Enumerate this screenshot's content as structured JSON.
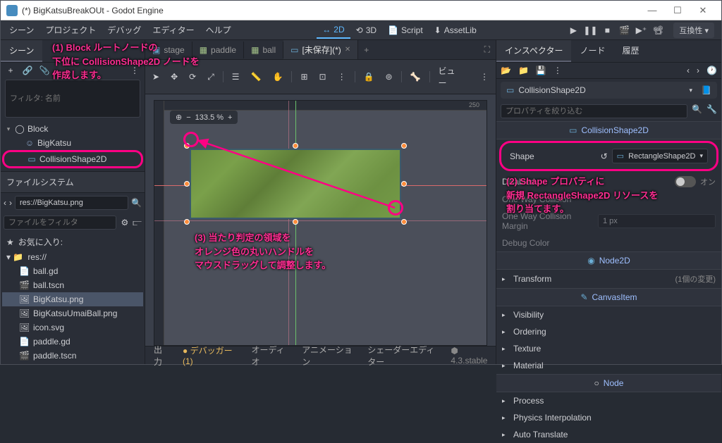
{
  "window": {
    "title": "(*) BigKatsuBreakOUt - Godot Engine"
  },
  "menubar": {
    "scene": "シーン",
    "project": "プロジェクト",
    "debug": "デバッグ",
    "editor": "エディター",
    "help": "ヘルプ"
  },
  "top_modes": {
    "2d": "2D",
    "3d": "3D",
    "script": "Script",
    "assetlib": "AssetLib"
  },
  "compat": "互換性",
  "left": {
    "tab_scene": "シーン",
    "filter_label": "フィルタ: 名前",
    "tree": {
      "block": "Block",
      "bigkatsu": "BigKatsu",
      "collision": "CollisionShape2D"
    },
    "filesystem": "ファイルシステム",
    "path": "res://BigKatsu.png",
    "file_filter": "ファイルをフィルタ",
    "favorites": "お気に入り:",
    "res_root": "res://",
    "files": {
      "ball_gd": "ball.gd",
      "ball_tscn": "ball.tscn",
      "bigkatsu_png": "BigKatsu.png",
      "umai": "BigKatsuUmaiBall.png",
      "icon": "icon.svg",
      "paddle_gd": "paddle.gd",
      "paddle_tscn": "paddle.tscn"
    }
  },
  "center": {
    "tabs": {
      "stage": "stage",
      "paddle": "paddle",
      "ball": "ball",
      "unsaved": "[未保存](*)"
    },
    "zoom": "133.5 %",
    "view_btn": "ビュー"
  },
  "bottom": {
    "output": "出力",
    "debugger": "デバッガー (1)",
    "audio": "オーディオ",
    "animation": "アニメーション",
    "shader": "シェーダーエディター",
    "version": "4.3.stable"
  },
  "right": {
    "tab_inspector": "インスペクター",
    "tab_node": "ノード",
    "tab_history": "履歴",
    "node_name": "CollisionShape2D",
    "filter_props": "プロパティを絞り込む",
    "sections": {
      "collision2d": "CollisionShape2D",
      "node2d": "Node2D",
      "canvasitem": "CanvasItem",
      "node": "Node"
    },
    "props": {
      "shape": "Shape",
      "shape_val": "RectangleShape2D",
      "disabled": "Disabled",
      "oneway": "One Way Collision",
      "margin": "One Way Collision Margin",
      "margin_val": "1 px",
      "debug_color": "Debug Color",
      "on": "オン",
      "transform": "Transform",
      "transform_note": "(1個の変更)",
      "visibility": "Visibility",
      "ordering": "Ordering",
      "texture": "Texture",
      "material": "Material",
      "process": "Process",
      "physics": "Physics Interpolation",
      "autotranslate": "Auto Translate"
    }
  },
  "annotations": {
    "a1_l1": "(1) Block ルートノードの",
    "a1_l2": "下位に CollisionShape2D ノードを",
    "a1_l3": "作成します。",
    "a2_l1": "(2) Shape プロパティに",
    "a2_l2": "新規 RectangleShape2D リソースを",
    "a2_l3": "割り当てます。",
    "a3_l1": "(3)  当たり判定の領域を",
    "a3_l2": "オレンジ色の丸いハンドルを",
    "a3_l3": "マウスドラッグして調整します。"
  }
}
